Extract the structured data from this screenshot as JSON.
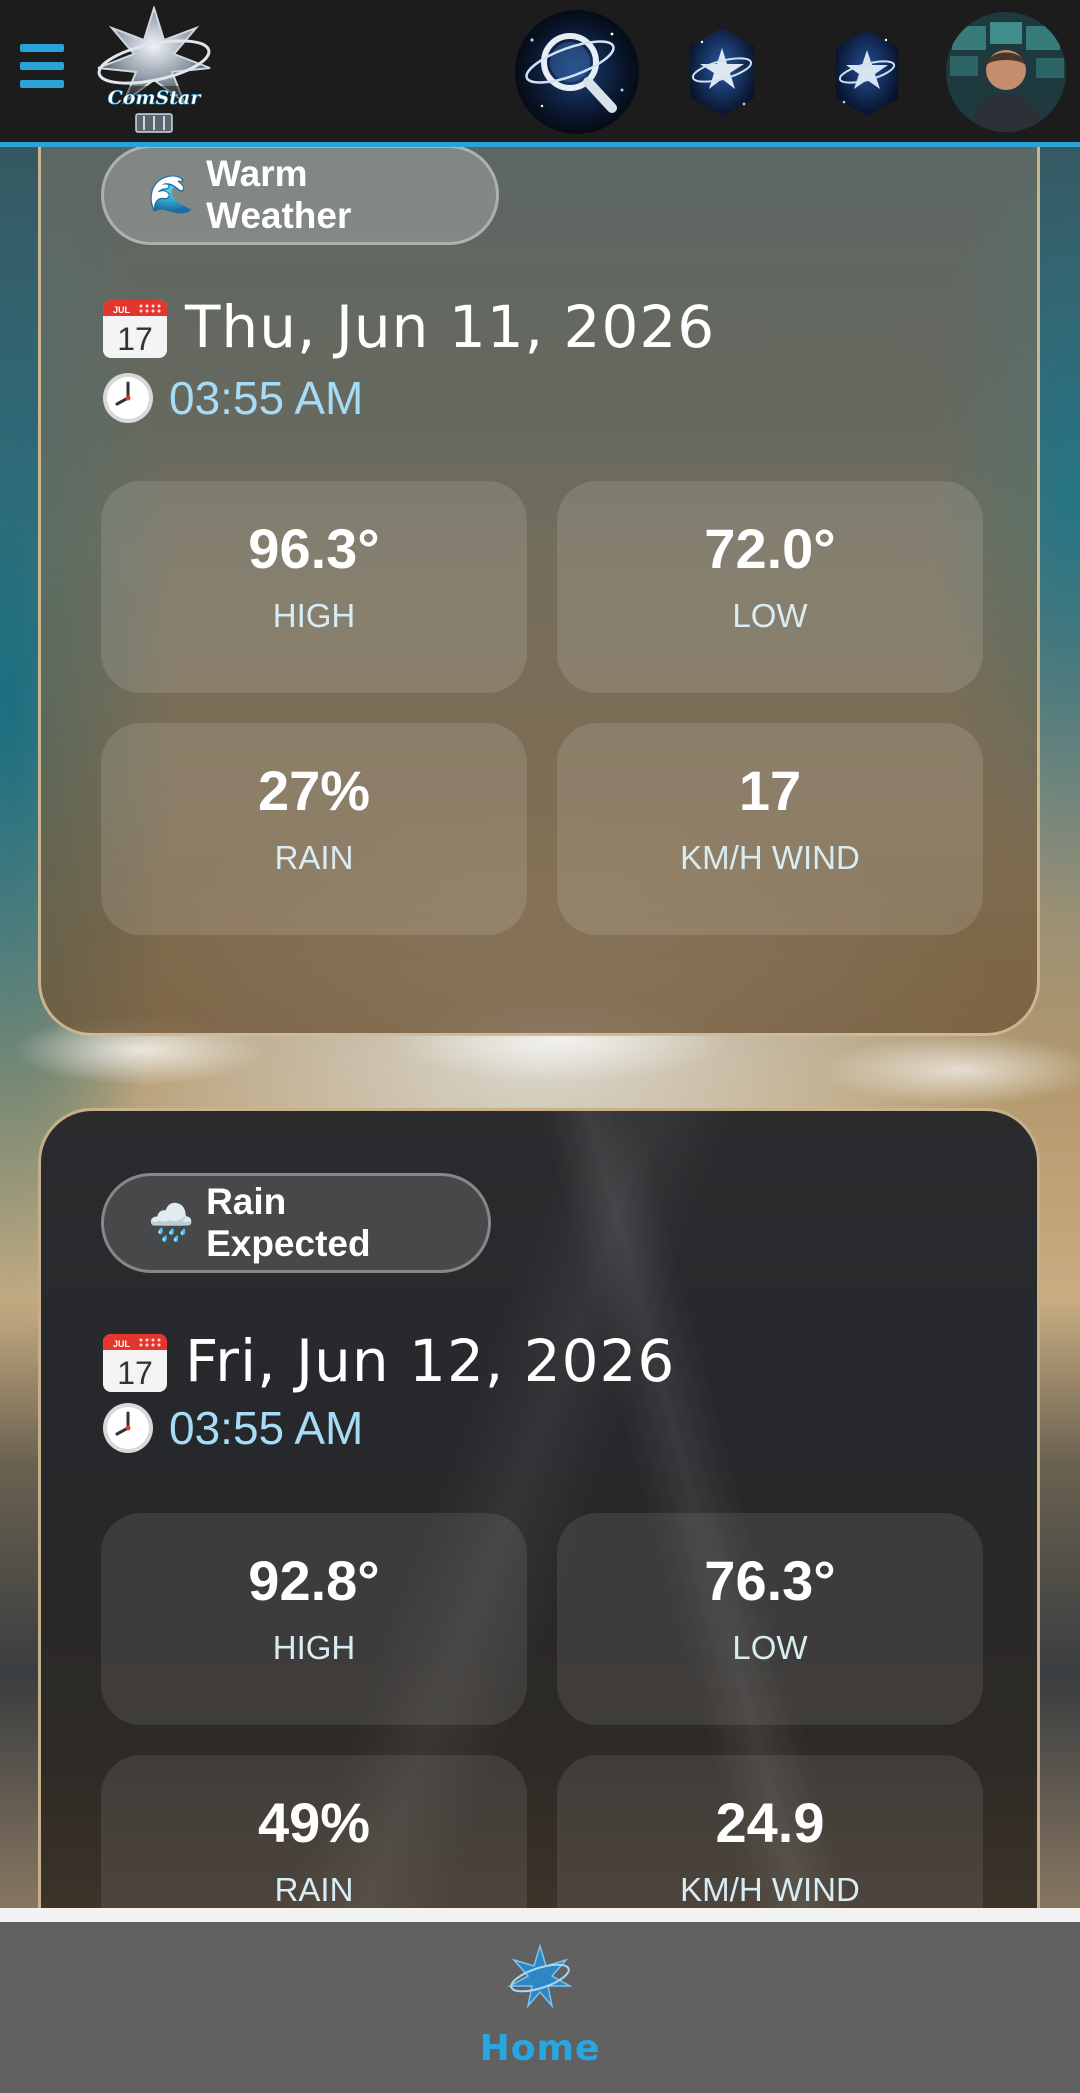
{
  "header": {
    "menu_icon": "hamburger-menu-icon",
    "logo_text": "ComStar",
    "nav_icons": [
      "search-globe-icon",
      "comstar-emblem-icon",
      "comstar-emblem-icon",
      "user-avatar"
    ]
  },
  "forecast": [
    {
      "badge_emoji": "🌊",
      "badge_label": "Warm Weather",
      "date": "Thu, Jun 11, 2026",
      "time": "03:55 AM",
      "high": "96.3°",
      "high_label": "HIGH",
      "low": "72.0°",
      "low_label": "LOW",
      "rain": "27%",
      "rain_label": "RAIN",
      "wind": "17",
      "wind_label": "KM/H WIND"
    },
    {
      "badge_emoji": "🌧️",
      "badge_label": "Rain Expected",
      "date": "Fri, Jun 12, 2026",
      "time": "03:55 AM",
      "high": "92.8°",
      "high_label": "HIGH",
      "low": "76.3°",
      "low_label": "LOW",
      "rain": "49%",
      "rain_label": "RAIN",
      "wind": "24.9",
      "wind_label": "KM/H WIND"
    }
  ],
  "calendar_icon": {
    "month": "JUL",
    "day": "17"
  },
  "bottom_nav": {
    "home_label": "Home",
    "home_icon": "comstar-emblem-icon"
  },
  "colors": {
    "accent": "#2aa3d8",
    "time_text": "#a6dcf6",
    "topbar_bg": "#1c1c1c",
    "bottombar_bg": "#616161"
  }
}
